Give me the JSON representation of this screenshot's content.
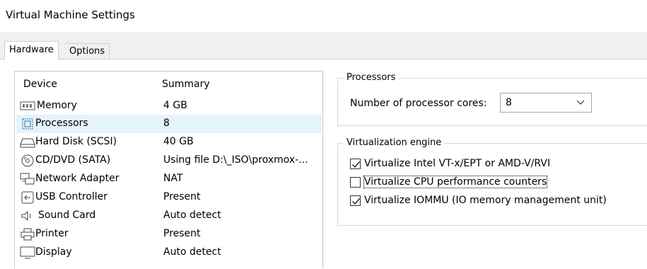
{
  "window": {
    "title": "Virtual Machine Settings"
  },
  "tabs": [
    {
      "label": "Hardware",
      "active": true
    },
    {
      "label": "Options",
      "active": false
    }
  ],
  "device_list": {
    "columns": [
      "Device",
      "Summary"
    ],
    "rows": [
      {
        "device": "Memory",
        "summary": "4 GB",
        "icon": "memory-icon",
        "selected": false
      },
      {
        "device": "Processors",
        "summary": "8",
        "icon": "processor-icon",
        "selected": true
      },
      {
        "device": "Hard Disk (SCSI)",
        "summary": "40 GB",
        "icon": "hard-disk-icon",
        "selected": false
      },
      {
        "device": "CD/DVD (SATA)",
        "summary": "Using file D:\\_ISO\\proxmox-...",
        "icon": "cd-dvd-icon",
        "selected": false
      },
      {
        "device": "Network Adapter",
        "summary": "NAT",
        "icon": "network-adapter-icon",
        "selected": false
      },
      {
        "device": "USB Controller",
        "summary": "Present",
        "icon": "usb-controller-icon",
        "selected": false
      },
      {
        "device": "Sound Card",
        "summary": "Auto detect",
        "icon": "sound-card-icon",
        "selected": false
      },
      {
        "device": "Printer",
        "summary": "Present",
        "icon": "printer-icon",
        "selected": false
      },
      {
        "device": "Display",
        "summary": "Auto detect",
        "icon": "display-icon",
        "selected": false
      }
    ]
  },
  "processors": {
    "legend": "Processors",
    "cores_label": "Number of processor cores:",
    "cores_value": "8"
  },
  "virtualization": {
    "legend": "Virtualization engine",
    "options": [
      {
        "label": "Virtualize Intel VT-x/EPT or AMD-V/RVI",
        "checked": true
      },
      {
        "label": "Virtualize CPU performance counters",
        "checked": false
      },
      {
        "label": "Virtualize IOMMU (IO memory management unit)",
        "checked": true
      }
    ]
  }
}
